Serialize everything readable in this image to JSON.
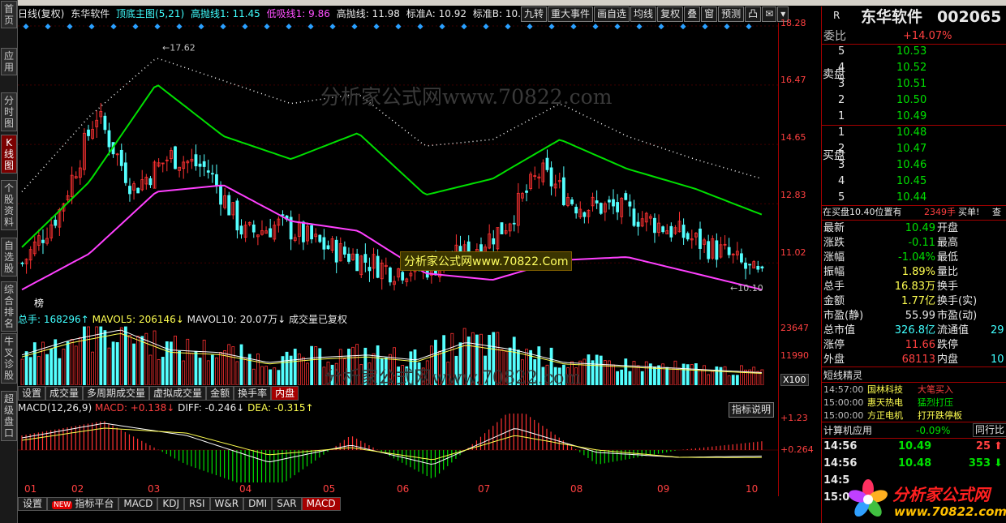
{
  "sidebar": [
    {
      "label": "首页",
      "active": false
    },
    {
      "label": "应用",
      "active": false
    },
    {
      "label": "分时图",
      "active": false
    },
    {
      "label": "K线图",
      "active": true
    },
    {
      "label": "个股资料",
      "active": false
    },
    {
      "label": "自选股",
      "active": false
    },
    {
      "label": "综合排名",
      "active": false
    },
    {
      "label": "牛叉诊股",
      "active": false
    },
    {
      "label": "超级盘口",
      "active": false
    }
  ],
  "title": {
    "period": "日线(复权)",
    "stock": "东华软件",
    "indicator": "顶底主图(5,21)",
    "high_line": "高抛线1: 11.45",
    "low_line": "低吸线1: 9.86",
    "high_line2": "高抛线: 11.98",
    "std_a": "标准A: 10.92",
    "std_b": "标准B: 10."
  },
  "toolbar": [
    "九转",
    "重大事件",
    "画自选",
    "均线",
    "复权",
    "叠",
    "窗",
    "预测"
  ],
  "price_axis": [
    "18.28",
    "16.47",
    "14.65",
    "12.83",
    "11.02"
  ],
  "price_annotations": {
    "high": "17.62",
    "low": "10.10",
    "tag": "榜"
  },
  "volume_info": {
    "total": "总手: 168296↑",
    "mavol5": "MAVOL5: 206146↓",
    "mavol10": "MAVOL10: 20.07万↓",
    "note": "成交量已复权"
  },
  "volume_axis": [
    "23647",
    "11990"
  ],
  "volume_unit": "X100",
  "volume_tabs": [
    "设置",
    "成交量",
    "多周期成交量",
    "虚拟成交量",
    "金额",
    "换手率",
    "内盘"
  ],
  "volume_tab_active": "内盘",
  "macd_info": {
    "name": "MACD(12,26,9)",
    "macd": "MACD: +0.138↓",
    "diff": "DIFF: -0.246↓",
    "dea": "DEA: -0.315↑",
    "explain": "指标说明"
  },
  "macd_axis": [
    "+1.23",
    "+0.264"
  ],
  "months": [
    "01",
    "02",
    "03",
    "04",
    "05",
    "06",
    "07",
    "08",
    "09",
    "10"
  ],
  "bottom_tabs": [
    "设置",
    "指标平台",
    "MACD",
    "KDJ",
    "RSI",
    "W&R",
    "DMI",
    "SAR",
    "MACD"
  ],
  "bottom_badge": "NEW",
  "bottom_tab_active": 8,
  "watermarks": {
    "top": "分析家公式网www.70822.com",
    "mid": "分析家公式网www.70822.Com",
    "vol": "分析家公式网www.70822.com"
  },
  "quote": {
    "flag": "R",
    "name": "东华软件",
    "code": "002065",
    "webi_label": "委比",
    "webi": "+14.07%",
    "sell_label": "卖盘",
    "buy_label": "买盘",
    "sell": [
      {
        "lvl": "5",
        "price": "10.53"
      },
      {
        "lvl": "4",
        "price": "10.52"
      },
      {
        "lvl": "3",
        "price": "10.51"
      },
      {
        "lvl": "2",
        "price": "10.50"
      },
      {
        "lvl": "1",
        "price": "10.49"
      }
    ],
    "buy": [
      {
        "lvl": "1",
        "price": "10.48"
      },
      {
        "lvl": "2",
        "price": "10.47"
      },
      {
        "lvl": "3",
        "price": "10.46"
      },
      {
        "lvl": "4",
        "price": "10.45"
      },
      {
        "lvl": "5",
        "price": "10.44"
      }
    ],
    "notice": "在买盘10.40位置有",
    "notice_vol": "2349手",
    "notice_act": "买单!",
    "notice_btn": "查",
    "stats": [
      {
        "l1": "最新",
        "v1": "10.49",
        "c1": "green",
        "l2": "开盘",
        "v2": ""
      },
      {
        "l1": "涨跌",
        "v1": "-0.11",
        "c1": "green",
        "l2": "最高",
        "v2": ""
      },
      {
        "l1": "涨幅",
        "v1": "-1.04%",
        "c1": "green",
        "l2": "最低",
        "v2": ""
      },
      {
        "l1": "振幅",
        "v1": "1.89%",
        "c1": "yellow",
        "l2": "量比",
        "v2": ""
      },
      {
        "l1": "总手",
        "v1": "16.83万",
        "c1": "yellow",
        "l2": "换手",
        "v2": ""
      },
      {
        "l1": "金额",
        "v1": "1.77亿",
        "c1": "yellow",
        "l2": "换手(实)",
        "v2": ""
      },
      {
        "l1": "市盈(静)",
        "v1": "55.99",
        "c1": "white",
        "l2": "市盈(动)",
        "v2": ""
      },
      {
        "l1": "总市值",
        "v1": "326.8亿",
        "c1": "cyan",
        "l2": "流通值",
        "v2": "29"
      },
      {
        "l1": "涨停",
        "v1": "11.66",
        "c1": "red",
        "l2": "跌停",
        "v2": ""
      },
      {
        "l1": "外盘",
        "v1": "68113",
        "c1": "red",
        "l2": "内盘",
        "v2": "10"
      }
    ],
    "sprite_title": "短线精灵",
    "sprite": [
      {
        "time": "14:57:00",
        "name": "国林科技",
        "event": "大笔买入",
        "ec": "red"
      },
      {
        "time": "15:00:00",
        "name": "惠天热电",
        "event": "猛烈打压",
        "ec": "green"
      },
      {
        "time": "15:00:00",
        "name": "方正电机",
        "event": "打开跌停板",
        "ec": "yellow"
      }
    ],
    "sector": {
      "name": "计算机应用",
      "pct": "-0.09%",
      "btn": "同行比"
    },
    "ticks": [
      {
        "time": "14:56",
        "price": "10.49",
        "vol": "25",
        "dir": "up"
      },
      {
        "time": "14:56",
        "price": "10.48",
        "vol": "353",
        "dir": "down"
      },
      {
        "time": "14:5",
        "price": "",
        "vol": "",
        "dir": ""
      },
      {
        "time": "15:0",
        "price": "",
        "vol": "",
        "dir": ""
      }
    ],
    "logo": {
      "text": "分析家公式网",
      "url": "www.70822.com"
    }
  },
  "chart_data": {
    "type": "candlestick",
    "x": [
      "01",
      "02",
      "03",
      "04",
      "05",
      "06",
      "07",
      "08",
      "09",
      "10"
    ],
    "ylim": [
      10.1,
      18.28
    ],
    "series": [
      {
        "name": "K",
        "close": [
          11.0,
          12.6,
          15.6,
          13.3,
          14.3,
          13.9,
          11.9,
          12.2,
          11.6,
          11.2,
          10.8,
          10.9,
          11.3,
          12.1,
          13.8,
          12.8,
          12.7,
          12.3,
          11.8,
          11.3,
          10.5
        ]
      },
      {
        "name": "upper",
        "values": [
          13.2,
          15.5,
          17.3,
          16.6,
          15.9,
          16.2,
          14.6,
          14.8,
          15.9,
          14.9,
          14.2,
          13.6
        ]
      },
      {
        "name": "mid",
        "values": [
          11.5,
          13.5,
          16.5,
          14.9,
          14.2,
          15.0,
          13.1,
          13.6,
          14.8,
          13.9,
          13.3,
          12.5
        ]
      },
      {
        "name": "lower",
        "values": [
          10.2,
          11.3,
          13.2,
          13.4,
          12.3,
          12.0,
          10.7,
          10.5,
          11.1,
          11.2,
          10.7,
          10.2
        ]
      }
    ],
    "volume": [
      12,
      18,
      22,
      14,
      13,
      9,
      11,
      12,
      10,
      17,
      14,
      9,
      8,
      7,
      6,
      5
    ],
    "macd": {
      "diff": [
        0.5,
        1.1,
        0.6,
        -0.5,
        0.2,
        -0.6,
        0.9,
        -0.1,
        -0.3,
        -0.25
      ],
      "dea": [
        0.4,
        0.9,
        0.7,
        -0.2,
        0.1,
        -0.4,
        0.6,
        0.0,
        -0.3,
        -0.31
      ]
    }
  }
}
